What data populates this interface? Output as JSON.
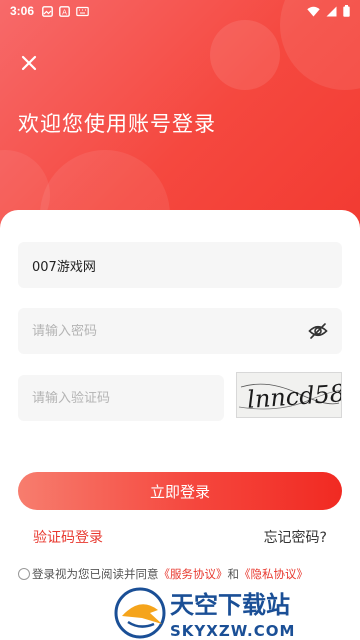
{
  "status_bar": {
    "time": "3:06"
  },
  "header": {
    "title": "欢迎您使用账号登录"
  },
  "form": {
    "account_value": "007游戏网",
    "password_placeholder": "请输入密码",
    "captcha_placeholder": "请输入验证码",
    "captcha_text": "lnncd58"
  },
  "buttons": {
    "login": "立即登录",
    "sms_login": "验证码登录",
    "forgot_password": "忘记密码?"
  },
  "agreement": {
    "prefix": "登录视为您已阅读并同意",
    "service": "《服务协议》",
    "and": "和",
    "privacy": "《隐私协议》"
  },
  "watermark": {
    "brand": "天空下载站",
    "domain": "SKYXZW.COM"
  },
  "colors": {
    "accent": "#f5463d",
    "link_red": "#e8392f"
  }
}
